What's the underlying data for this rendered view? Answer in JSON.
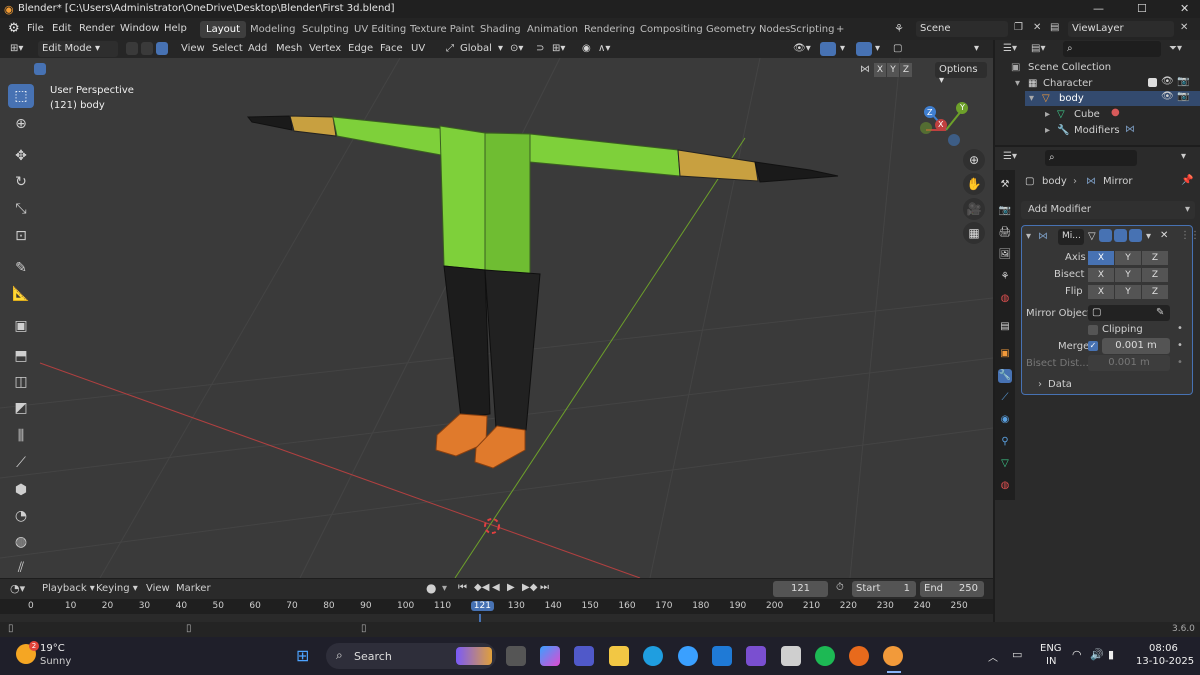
{
  "title_bar": {
    "title": "Blender* [C:\\Users\\Administrator\\OneDrive\\Desktop\\Blender\\First 3d.blend]",
    "minimize": "—",
    "maximize": "☐",
    "close": "✕"
  },
  "menus": [
    "File",
    "Edit",
    "Render",
    "Window",
    "Help"
  ],
  "workspaces": [
    {
      "label": "Layout",
      "active": true
    },
    {
      "label": "Modeling"
    },
    {
      "label": "Sculpting"
    },
    {
      "label": "UV Editing"
    },
    {
      "label": "Texture Paint"
    },
    {
      "label": "Shading"
    },
    {
      "label": "Animation"
    },
    {
      "label": "Rendering"
    },
    {
      "label": "Compositing"
    },
    {
      "label": "Geometry Nodes"
    },
    {
      "label": "Scripting"
    },
    {
      "label": "+"
    }
  ],
  "scene": {
    "label": "Scene"
  },
  "view_layer": {
    "label": "ViewLayer"
  },
  "header3d": {
    "mode": "Edit Mode",
    "menu": [
      "View",
      "Select",
      "Add",
      "Mesh",
      "Vertex",
      "Edge",
      "Face",
      "UV"
    ],
    "transform": "Global",
    "options": "Options",
    "axes": [
      "X",
      "Y",
      "Z"
    ]
  },
  "viewport": {
    "perspective": "User Perspective",
    "object_info": "(121) body",
    "gizmo": {
      "x": "X",
      "y": "Y",
      "z": "Z"
    },
    "colors": {
      "background": "#3a3a3a",
      "shirt": "#7ed03a",
      "pants": "#1c1c1c",
      "shoes": "#e07a2c",
      "skin": "#c8a040",
      "x_axis": "#c0403f",
      "y_axis": "#6da02a"
    }
  },
  "outliner": {
    "title": "Scene Collection",
    "items": [
      {
        "label": "Character",
        "icon": "collection-icon"
      },
      {
        "label": "body",
        "icon": "mesh-object-icon"
      },
      {
        "label": "Cube",
        "icon": "mesh-data-icon"
      },
      {
        "label": "Modifiers",
        "icon": "wrench-icon"
      }
    ]
  },
  "properties": {
    "breadcrumb_object": "body",
    "breadcrumb_modifier": "Mirror",
    "add_modifier": "Add Modifier",
    "modifier_name": "Mi...",
    "axis_label": "Axis",
    "bisect_label": "Bisect",
    "flip_label": "Flip",
    "mirror_object_label": "Mirror Object",
    "clipping_label": "Clipping",
    "merge_label": "Merge",
    "merge_value": "0.001 m",
    "bisect_dist_label": "Bisect Dist...",
    "bisect_dist_value": "0.001 m",
    "data_label": "Data",
    "axis_state": {
      "x": true,
      "y": false,
      "z": false
    },
    "merge_checked": true,
    "clipping_checked": false
  },
  "timeline": {
    "menus": [
      "Playback",
      "Keying",
      "View",
      "Marker"
    ],
    "current_frame": "121",
    "start_label": "Start",
    "start_value": "1",
    "end_label": "End",
    "end_value": "250",
    "ruler": [
      "0",
      "10",
      "20",
      "30",
      "40",
      "50",
      "60",
      "70",
      "80",
      "90",
      "100",
      "110",
      "121",
      "130",
      "140",
      "150",
      "160",
      "170",
      "180",
      "190",
      "200",
      "210",
      "220",
      "230",
      "240",
      "250"
    ]
  },
  "status": {
    "version": "3.6.0"
  },
  "taskbar": {
    "weather_temp": "19°C",
    "weather_desc": "Sunny",
    "weather_badge": "2",
    "search": "Search",
    "lang1": "ENG",
    "lang2": "IN",
    "time": "08:06",
    "date": "13-10-2025"
  }
}
